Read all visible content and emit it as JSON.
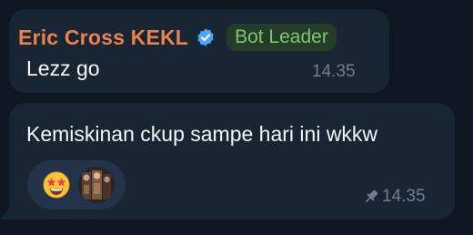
{
  "messages": [
    {
      "sender": "Eric Cross KEKL",
      "verified_icon": "verified-badge-icon",
      "role_badge": "Bot Leader",
      "text": "Lezz go",
      "time": "14.35"
    },
    {
      "text": "Kemiskinan ckup sampe hari ini wkkw",
      "time": "14.35",
      "pinned_icon": "pin-icon",
      "reaction": {
        "emoji_icon": "star-struck-emoji-icon",
        "reactor_avatar": "reactor-avatar"
      }
    }
  ],
  "colors": {
    "background": "#0e1621",
    "bubble": "#182533",
    "sender_name": "#e9824e",
    "badge_text": "#7bc86b",
    "badge_bg": "#263c2a",
    "timestamp": "#6e7f90",
    "verified": "#4ea4f6"
  }
}
